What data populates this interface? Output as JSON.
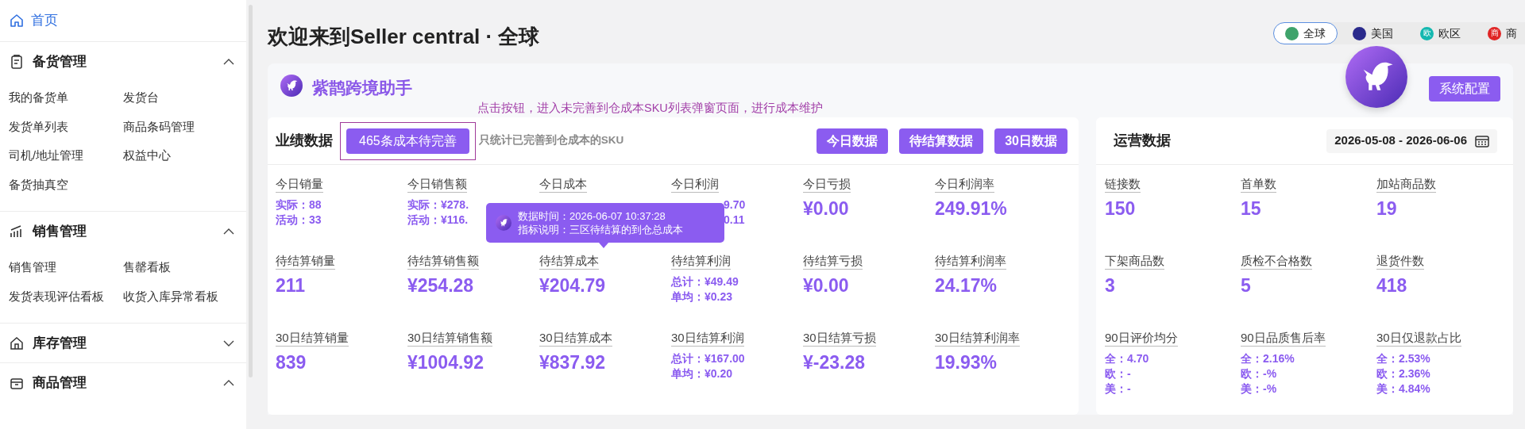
{
  "sidebar": {
    "items": [
      {
        "kind": "link",
        "label": "首页",
        "selected": true
      },
      {
        "kind": "group",
        "label": "备货管理",
        "expanded": true,
        "children": [
          {
            "label": "我的备货单"
          },
          {
            "label": "发货台"
          },
          {
            "label": "发货单列表"
          },
          {
            "label": "商品条码管理"
          },
          {
            "label": "司机/地址管理"
          },
          {
            "label": "权益中心"
          },
          {
            "label": "备货抽真空"
          }
        ]
      },
      {
        "kind": "group",
        "label": "销售管理",
        "expanded": true,
        "children": [
          {
            "label": "销售管理"
          },
          {
            "label": "售罄看板"
          },
          {
            "label": "发货表现评估看板"
          },
          {
            "label": "收货入库异常看板"
          }
        ]
      },
      {
        "kind": "group",
        "label": "库存管理",
        "expanded": false
      },
      {
        "kind": "group",
        "label": "商品管理",
        "expanded": true
      }
    ]
  },
  "header": {
    "title": "欢迎来到Seller central · 全球",
    "regions": [
      {
        "label": "全球",
        "selected": true,
        "color": "#3fa36b"
      },
      {
        "label": "美国",
        "selected": false,
        "color": "#2a2a8c"
      },
      {
        "label": "欧区",
        "selected": false,
        "color": "#14b8b0",
        "badge": "欧"
      },
      {
        "label": "商",
        "selected": false,
        "color": "#e02424",
        "badge": "商"
      }
    ]
  },
  "assistant": {
    "name": "紫鹊跨境助手",
    "hint": "点击按钮，进入未完善到仓成本SKU列表弹窗页面，进行成本维护",
    "config_button": "系统配置"
  },
  "performance": {
    "title": "业绩数据",
    "pending_button": "465条成本待完善",
    "pending_highlighted": true,
    "note": "只统计已完善到仓成本的SKU",
    "buttons": [
      "今日数据",
      "待结算数据",
      "30日数据"
    ],
    "rows": [
      [
        {
          "label": "今日销量",
          "lines": [
            "实际：88",
            "活动：33"
          ]
        },
        {
          "label": "今日销售额",
          "lines": [
            "实际：¥278.",
            "活动：¥116."
          ]
        },
        {
          "label": "今日成本"
        },
        {
          "label": "今日利润",
          "lines": [
            "9.70",
            "0.11"
          ],
          "covered": true
        },
        {
          "label": "今日亏损",
          "value": "¥0.00"
        },
        {
          "label": "今日利润率",
          "value": "249.91%"
        }
      ],
      [
        {
          "label": "待结算销量",
          "value": "211"
        },
        {
          "label": "待结算销售额",
          "value": "¥254.28"
        },
        {
          "label": "待结算成本",
          "value": "¥204.79"
        },
        {
          "label": "待结算利润",
          "lines": [
            "总计：¥49.49",
            "单均：¥0.23"
          ]
        },
        {
          "label": "待结算亏损",
          "value": "¥0.00"
        },
        {
          "label": "待结算利润率",
          "value": "24.17%"
        }
      ],
      [
        {
          "label": "30日结算销量",
          "value": "839"
        },
        {
          "label": "30日结算销售额",
          "value": "¥1004.92"
        },
        {
          "label": "30日结算成本",
          "value": "¥837.92"
        },
        {
          "label": "30日结算利润",
          "lines": [
            "总计：¥167.00",
            "单均：¥0.20"
          ]
        },
        {
          "label": "30日结算亏损",
          "value": "¥-23.28"
        },
        {
          "label": "30日结算利润率",
          "value": "19.93%"
        }
      ]
    ],
    "tooltip": {
      "lines": [
        "数据时间：2026-06-07 10:37:28",
        "指标说明：三区待结算的到仓总成本"
      ]
    }
  },
  "operations": {
    "title": "运营数据",
    "date_range": "2026-05-08 - 2026-06-06",
    "rows": [
      [
        {
          "label": "链接数",
          "value": "150"
        },
        {
          "label": "首单数",
          "value": "15"
        },
        {
          "label": "加站商品数",
          "value": "19"
        }
      ],
      [
        {
          "label": "下架商品数",
          "value": "3"
        },
        {
          "label": "质检不合格数",
          "value": "5"
        },
        {
          "label": "退货件数",
          "value": "418"
        }
      ],
      [
        {
          "label": "90日评价均分",
          "lines": [
            "全：4.70",
            "欧：-",
            "美：-"
          ]
        },
        {
          "label": "90日品质售后率",
          "lines": [
            "全：2.16%",
            "欧：-%",
            "美：-%"
          ]
        },
        {
          "label": "30日仅退款占比",
          "lines": [
            "全：2.53%",
            "欧：2.36%",
            "美：4.84%"
          ]
        }
      ]
    ]
  }
}
